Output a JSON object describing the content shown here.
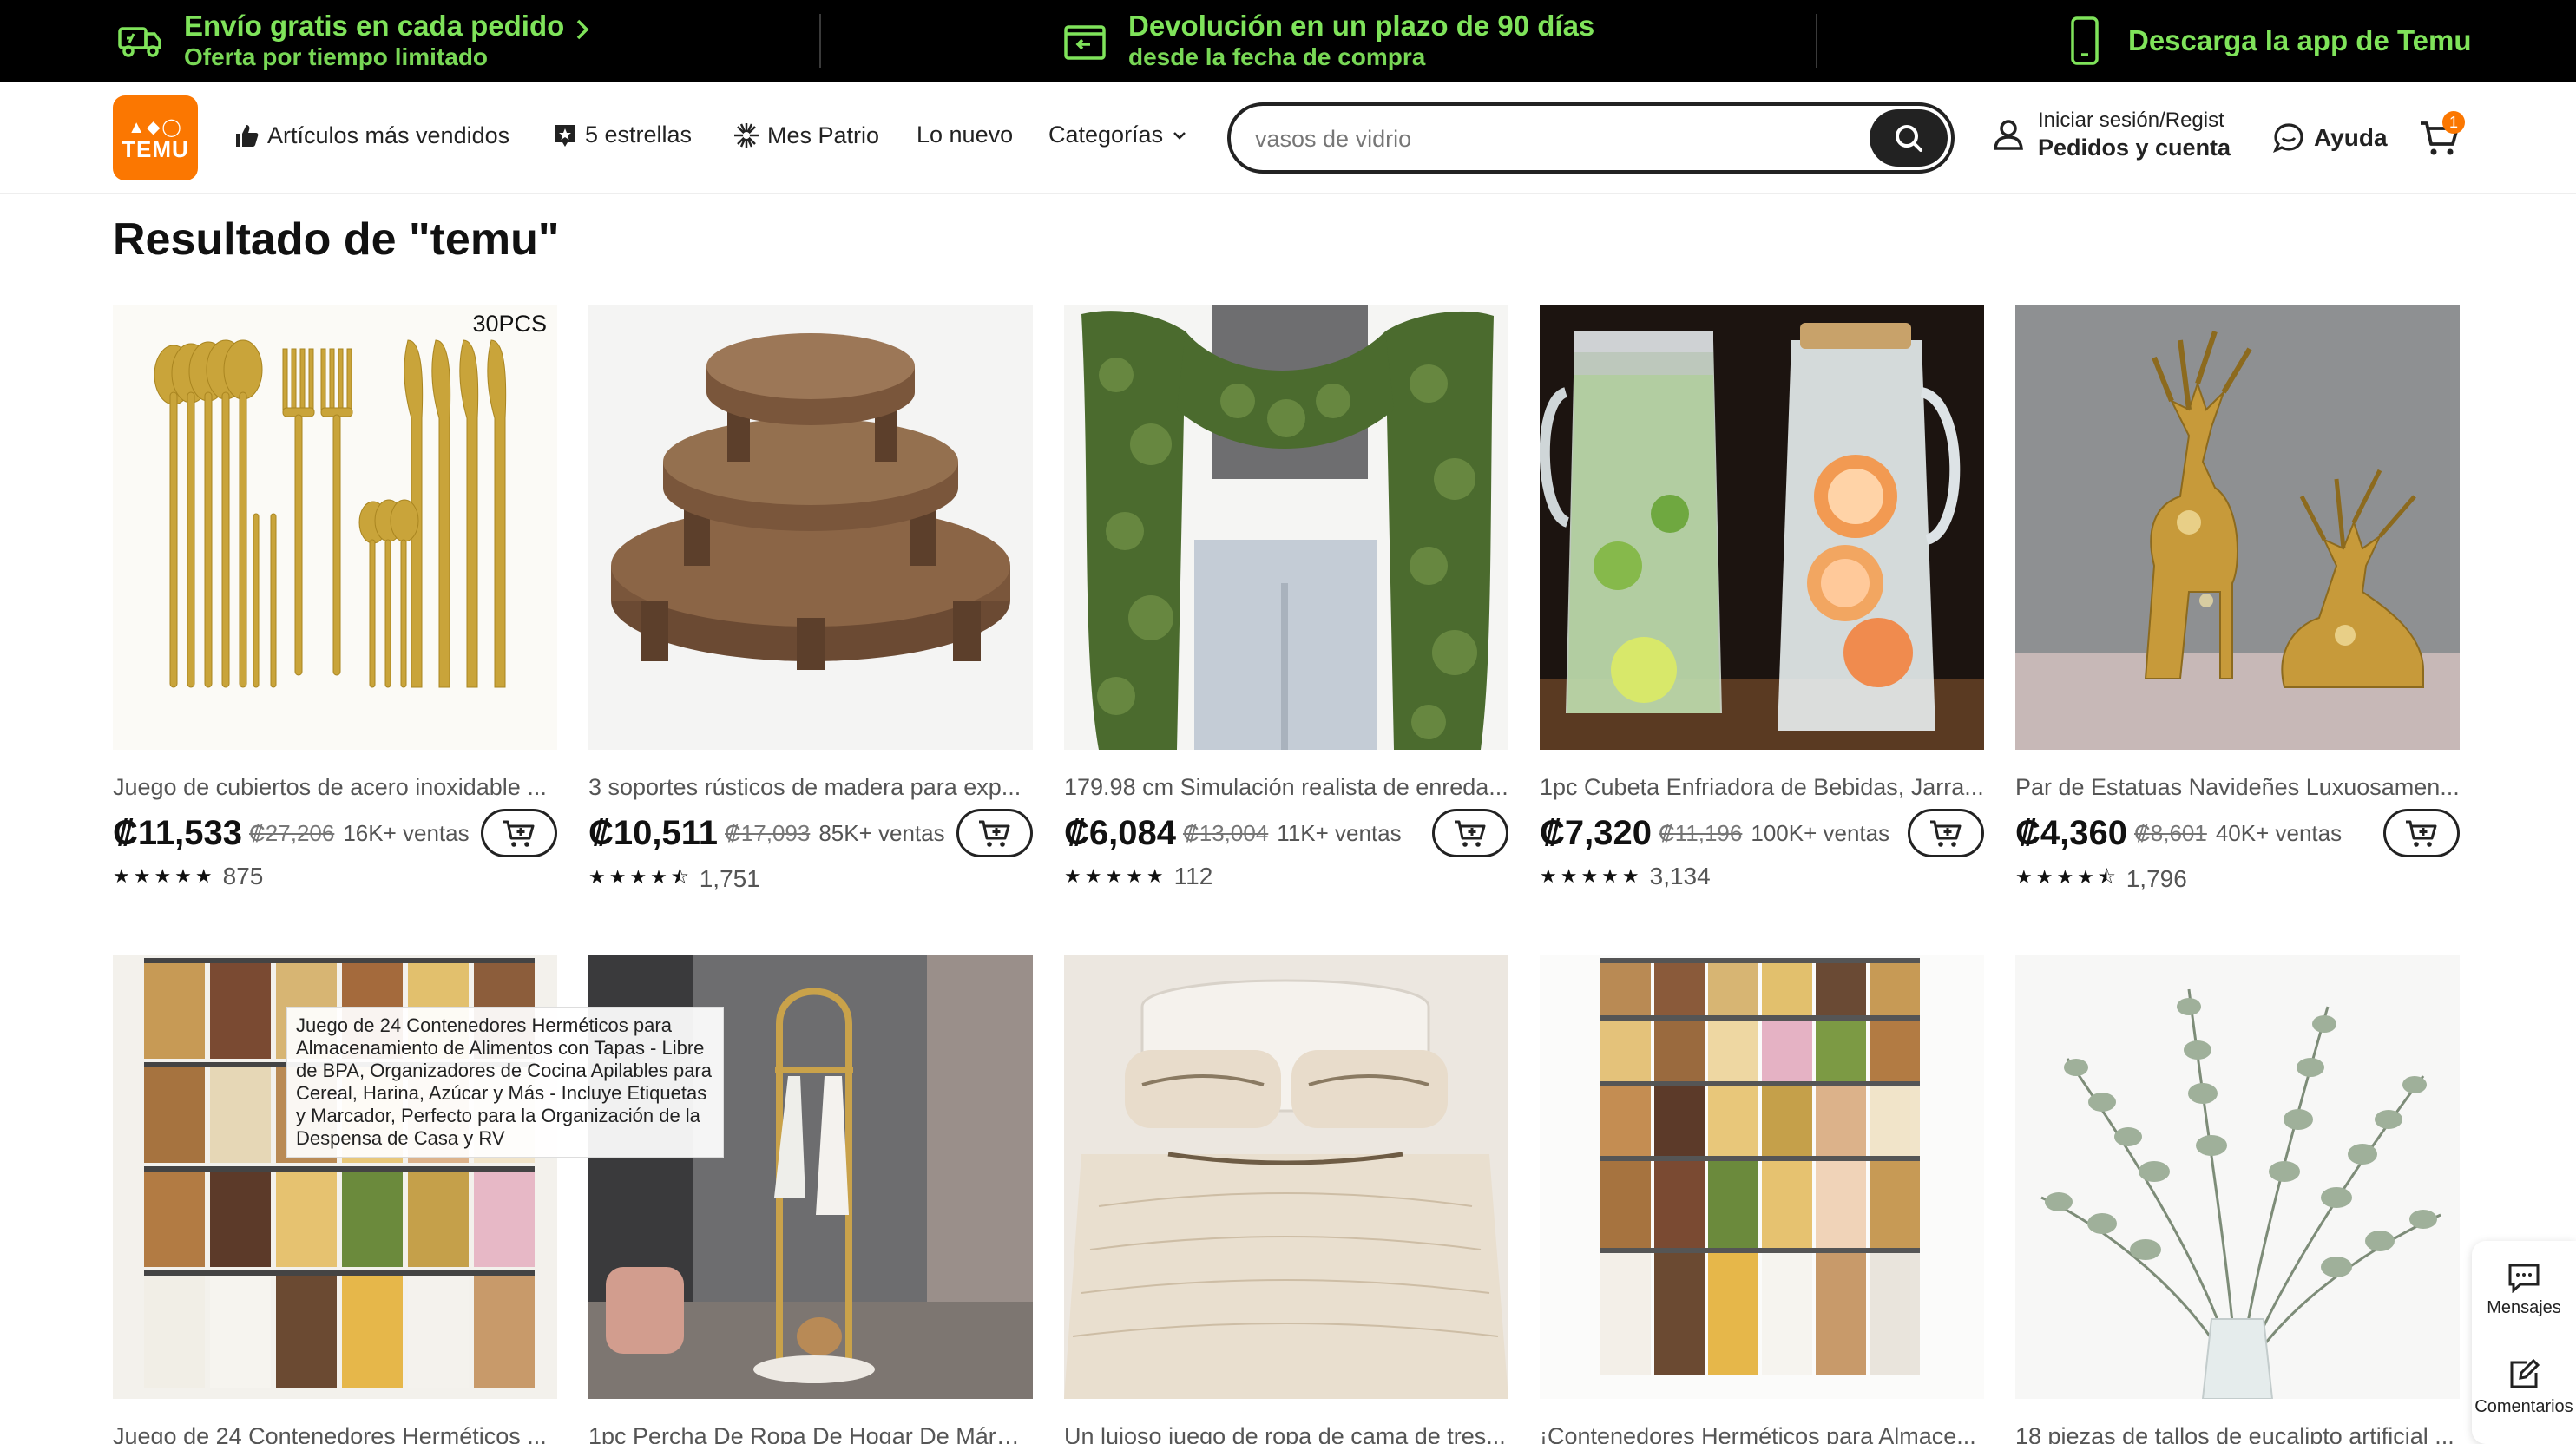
{
  "promo": {
    "shipping_title": "Envío gratis en cada pedido",
    "shipping_sub": "Oferta por tiempo limitado",
    "return_title": "Devolución en un plazo de 90 días",
    "return_sub": "desde la fecha de compra",
    "app_title": "Descarga la app de Temu"
  },
  "header": {
    "logo_text": "TEMU",
    "nav": {
      "bestsellers": "Artículos más vendidos",
      "five_stars": "5 estrellas",
      "mes_patrio": "Mes Patrio",
      "new": "Lo nuevo",
      "categories": "Categorías"
    },
    "search": {
      "value": "vasos de vidrio"
    },
    "account": {
      "line1": "Iniciar sesión/Regist",
      "line2": "Pedidos y cuenta"
    },
    "help": "Ayuda",
    "cart_count": "1"
  },
  "results_title": "Resultado de \"temu\"",
  "products": [
    {
      "title": "Juego de cubiertos de acero inoxidable ...",
      "price": "₡11,533",
      "old_price": "₡27,206",
      "sold": "16K+ ventas",
      "stars": "★★★★★",
      "reviews": "875",
      "badge": "30PCS"
    },
    {
      "title": "3 soportes rústicos de madera para exp...",
      "price": "₡10,511",
      "old_price": "₡17,093",
      "sold": "85K+ ventas",
      "stars": "★★★★⯪",
      "reviews": "1,751"
    },
    {
      "title": "179.98 cm Simulación realista de enreda...",
      "price": "₡6,084",
      "old_price": "₡13,004",
      "sold": "11K+ ventas",
      "stars": "★★★★★",
      "reviews": "112"
    },
    {
      "title": "1pc Cubeta Enfriadora de Bebidas, Jarra...",
      "price": "₡7,320",
      "old_price": "₡11,196",
      "sold": "100K+ ventas",
      "stars": "★★★★★",
      "reviews": "3,134"
    },
    {
      "title": "Par de Estatuas Navideñes Luxuosamen...",
      "price": "₡4,360",
      "old_price": "₡8,601",
      "sold": "40K+ ventas",
      "stars": "★★★★⯪",
      "reviews": "1,796"
    },
    {
      "title": "Juego de 24 Contenedores Herméticos ..."
    },
    {
      "title": "1pc Percha De Ropa De Hogar De Márm..."
    },
    {
      "title": "Un lujoso juego de ropa de cama de tres..."
    },
    {
      "title": "¡Contenedores Herméticos para Almace..."
    },
    {
      "title": "18 piezas de tallos de eucalipto artificial ..."
    }
  ],
  "tooltip": "Juego de 24 Contenedores Herméticos para Almacenamiento de Alimentos con Tapas - Libre de BPA, Organizadores de Cocina Apilables para Cereal, Harina, Azúcar y Más - Incluye Etiquetas y Marcador, Perfecto para la Organización de la Despensa de Casa y RV",
  "side_panel": {
    "messages": "Mensajes",
    "comments": "Comentarios"
  },
  "colors": {
    "brand": "#fb7701",
    "promo_text": "#7fe35a"
  }
}
